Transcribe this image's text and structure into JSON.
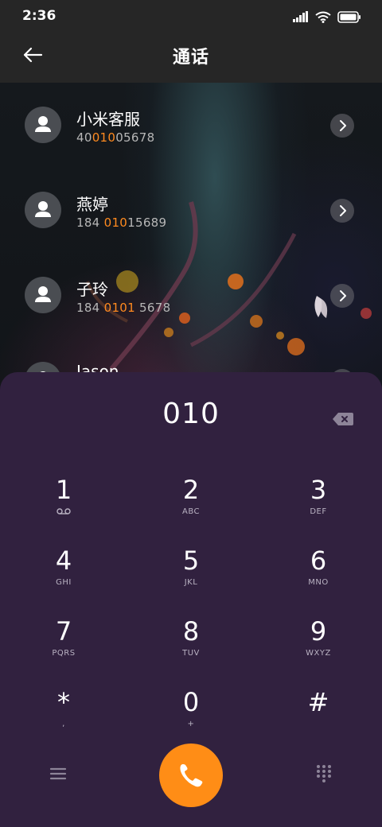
{
  "status_bar": {
    "time": "2:36",
    "icons": [
      "signal-icon",
      "wifi-icon",
      "battery-icon"
    ]
  },
  "header": {
    "title": "通话",
    "back_icon": "arrow-left-icon"
  },
  "contacts": [
    {
      "name": "小米客服",
      "number_prefix": "40",
      "number_match": "010",
      "number_suffix": "05678"
    },
    {
      "name": "燕婷",
      "number_prefix": "184 ",
      "number_match": "010",
      "number_suffix": "15689"
    },
    {
      "name": "子玲",
      "number_prefix": "184 ",
      "number_match": "0101",
      "number_suffix": " 5678"
    },
    {
      "name": "Jason",
      "number_prefix": "",
      "number_match": "",
      "number_suffix": ""
    }
  ],
  "dialpad": {
    "input": "010",
    "keys": [
      {
        "digit": "1",
        "letters": ""
      },
      {
        "digit": "2",
        "letters": "ABC"
      },
      {
        "digit": "3",
        "letters": "DEF"
      },
      {
        "digit": "4",
        "letters": "GHI"
      },
      {
        "digit": "5",
        "letters": "JKL"
      },
      {
        "digit": "6",
        "letters": "MNO"
      },
      {
        "digit": "7",
        "letters": "PQRS"
      },
      {
        "digit": "8",
        "letters": "TUV"
      },
      {
        "digit": "9",
        "letters": "WXYZ"
      },
      {
        "digit": "*",
        "letters": ","
      },
      {
        "digit": "0",
        "letters": "+"
      },
      {
        "digit": "#",
        "letters": ""
      }
    ],
    "colors": {
      "background": "#31213f",
      "call_button": "#ff8d16",
      "highlight": "#ff8a1f"
    }
  }
}
